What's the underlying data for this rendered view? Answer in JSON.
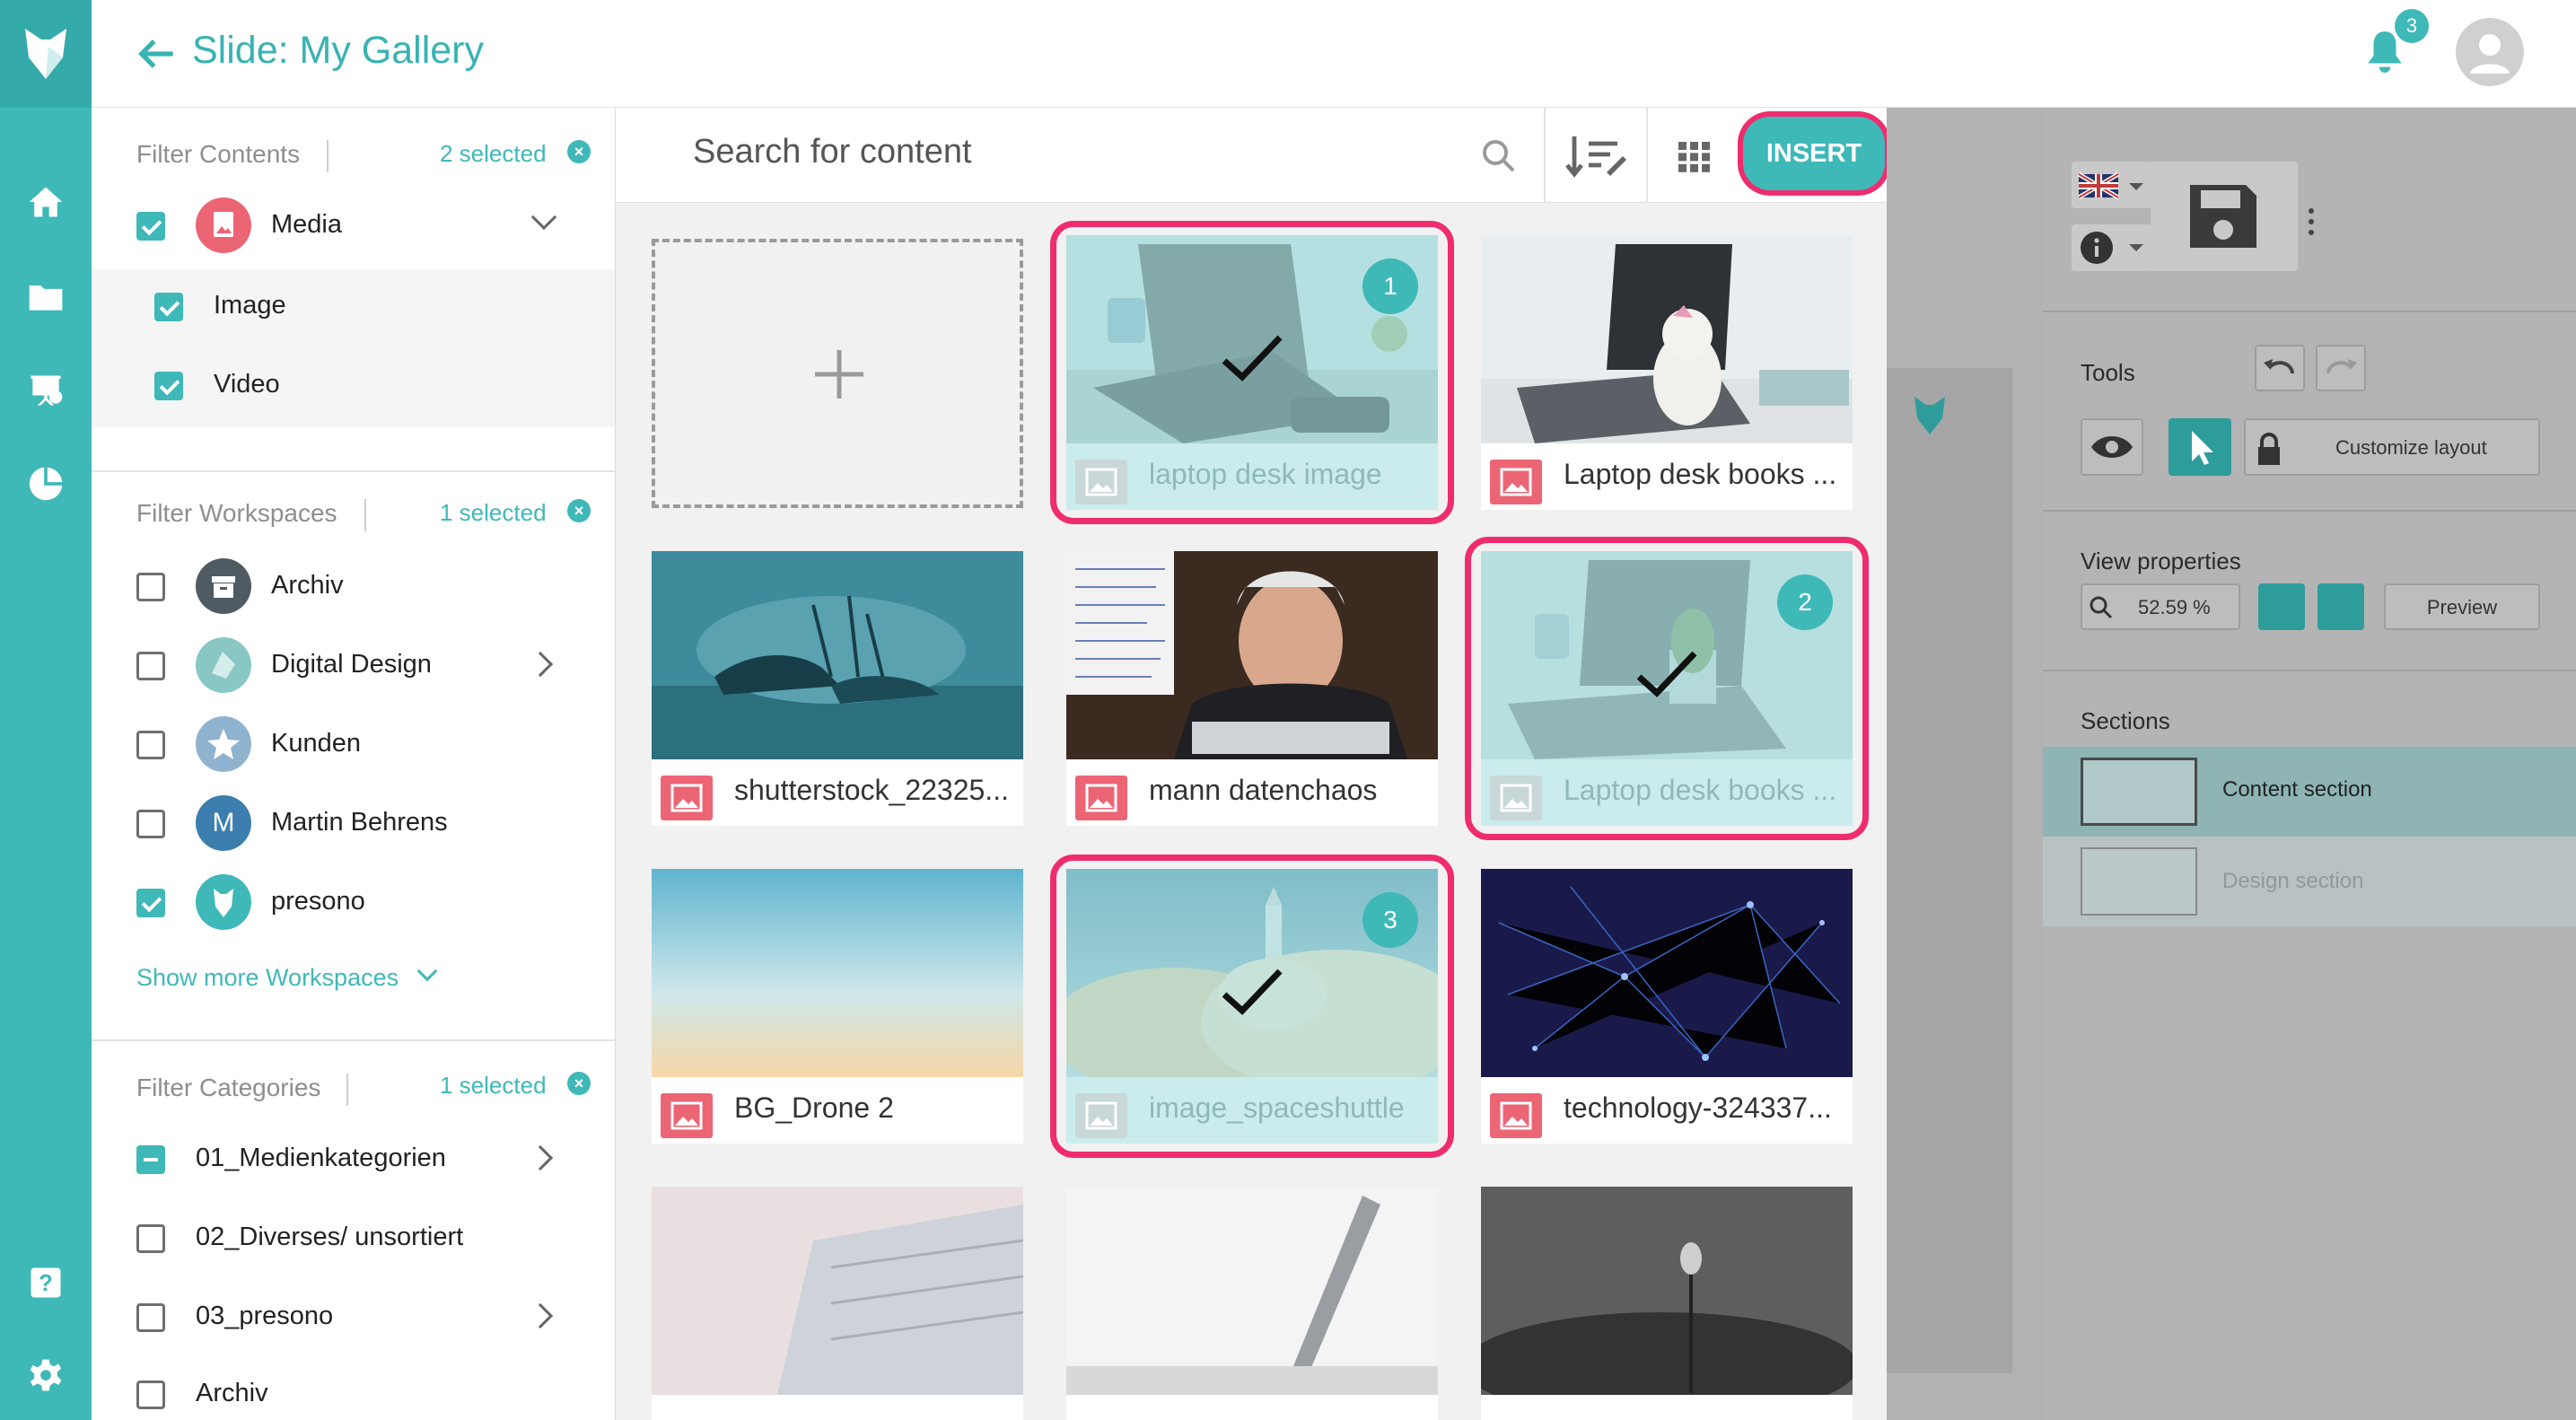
{
  "header": {
    "title": "Slide: My Gallery",
    "notification_count": "3"
  },
  "filters": {
    "contents": {
      "title": "Filter Contents",
      "selected": "2 selected",
      "items": [
        {
          "label": "Media",
          "checked": true
        },
        {
          "label": "Image",
          "checked": true
        },
        {
          "label": "Video",
          "checked": true
        }
      ]
    },
    "workspaces": {
      "title": "Filter Workspaces",
      "selected": "1 selected",
      "items": [
        {
          "label": "Archiv",
          "checked": false
        },
        {
          "label": "Digital Design",
          "checked": false
        },
        {
          "label": "Kunden",
          "checked": false
        },
        {
          "label": "Martin Behrens",
          "checked": false,
          "initial": "M"
        },
        {
          "label": "presono",
          "checked": true
        }
      ],
      "show_more": "Show more Workspaces"
    },
    "categories": {
      "title": "Filter Categories",
      "selected": "1 selected",
      "items": [
        {
          "label": "01_Medienkategorien",
          "state": "partial"
        },
        {
          "label": "02_Diverses/ unsortiert",
          "state": "unchecked"
        },
        {
          "label": "03_presono",
          "state": "unchecked"
        },
        {
          "label": "Archiv",
          "state": "unchecked"
        }
      ]
    }
  },
  "search": {
    "placeholder": "Search for content",
    "insert_label": "INSERT"
  },
  "tiles": [
    {
      "label": "laptop desk image",
      "selected": true,
      "order": "1"
    },
    {
      "label": "Laptop desk books ...",
      "selected": false
    },
    {
      "label": "shutterstock_22325...",
      "selected": false
    },
    {
      "label": "mann datenchaos",
      "selected": false
    },
    {
      "label": "Laptop desk books ...",
      "selected": true,
      "order": "2"
    },
    {
      "label": "BG_Drone 2",
      "selected": false
    },
    {
      "label": "image_spaceshuttle",
      "selected": true,
      "order": "3"
    },
    {
      "label": "technology-324337...",
      "selected": false
    }
  ],
  "editor": {
    "tools_title": "Tools",
    "customize_layout": "Customize layout",
    "view_properties_title": "View properties",
    "zoom": "52.59 %",
    "preview": "Preview",
    "sections_title": "Sections",
    "sections": [
      "Content section",
      "Design section"
    ]
  },
  "colors": {
    "accent": "#3fb8b8",
    "highlight": "#ef2c6e",
    "media_icon": "#ec6575"
  }
}
